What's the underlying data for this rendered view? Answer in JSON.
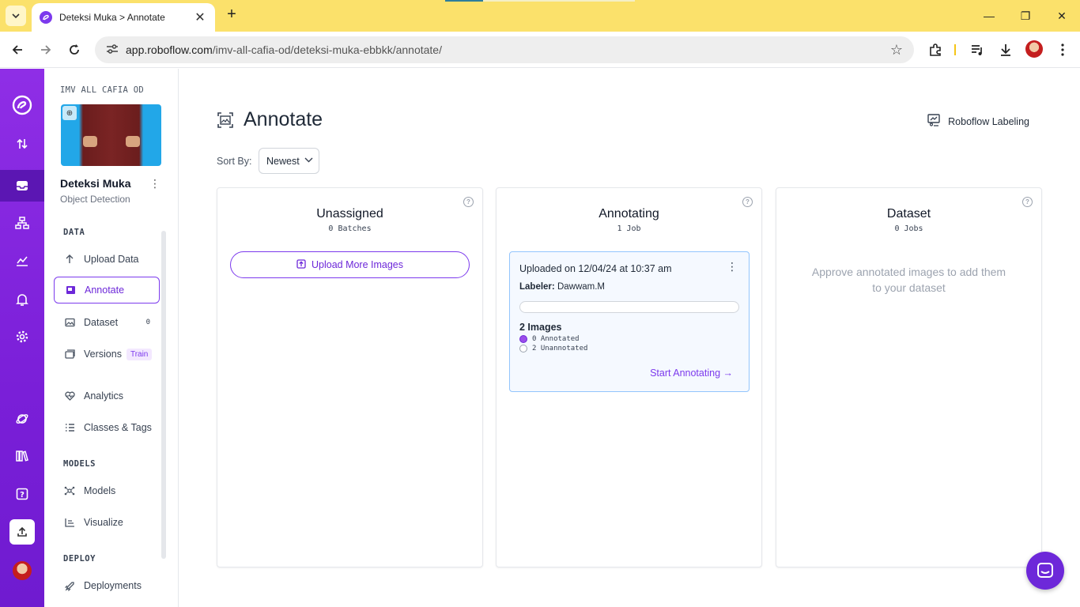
{
  "browser": {
    "tab_title": "Deteksi Muka > Annotate",
    "url_host": "app.roboflow.com",
    "url_path": "/imv-all-cafia-od/deteksi-muka-ebbkk/annotate/"
  },
  "sidebar": {
    "workspace": "IMV ALL CAFIA OD",
    "project_name": "Deteksi Muka",
    "project_type": "Object Detection",
    "sections": {
      "data": "DATA",
      "models": "MODELS",
      "deploy": "DEPLOY"
    },
    "items": {
      "upload": "Upload Data",
      "annotate": "Annotate",
      "dataset": "Dataset",
      "dataset_count": "0",
      "versions": "Versions",
      "train_badge": "Train",
      "analytics": "Analytics",
      "classes": "Classes & Tags",
      "models": "Models",
      "visualize": "Visualize",
      "deployments": "Deployments"
    }
  },
  "header": {
    "title": "Annotate",
    "labeling_link": "Roboflow Labeling",
    "sort_label": "Sort By:",
    "sort_value": "Newest"
  },
  "columns": {
    "unassigned": {
      "title": "Unassigned",
      "subtitle": "0 Batches",
      "button": "Upload More Images"
    },
    "annotating": {
      "title": "Annotating",
      "subtitle": "1 Job",
      "job": {
        "title": "Uploaded on 12/04/24 at 10:37 am",
        "labeler_label": "Labeler:",
        "labeler_name": "Dawwam.M",
        "progress": 0,
        "images": "2 Images",
        "annotated": "0 Annotated",
        "unannotated": "2 Unannotated",
        "action": "Start Annotating"
      }
    },
    "dataset": {
      "title": "Dataset",
      "subtitle": "0 Jobs",
      "empty_line1": "Approve annotated images to add them",
      "empty_line2": "to your dataset"
    }
  },
  "colors": {
    "accent": "#7c3aed",
    "rail": "#8f2ee6",
    "tabbar": "#fbe16b"
  }
}
